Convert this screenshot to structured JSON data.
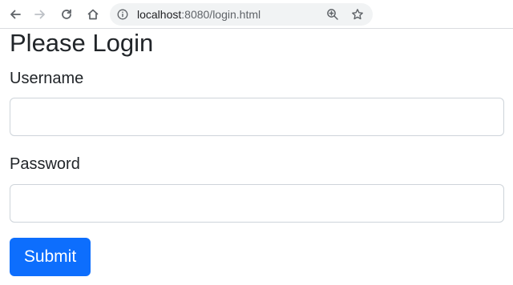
{
  "browser": {
    "url_host": "localhost",
    "url_rest": ":8080/login.html",
    "icons": {
      "back": "arrow-left-icon",
      "forward": "arrow-right-icon",
      "reload": "reload-icon",
      "home": "home-icon",
      "site_info": "info-icon",
      "zoom": "zoom-in-icon",
      "bookmark": "star-icon"
    },
    "forward_enabled": false
  },
  "page": {
    "title": "Please Login",
    "username_label": "Username",
    "username_value": "",
    "password_label": "Password",
    "password_value": "",
    "submit_label": "Submit",
    "colors": {
      "primary": "#0d6efd",
      "text": "#212529",
      "input_border": "#ced4da"
    }
  }
}
